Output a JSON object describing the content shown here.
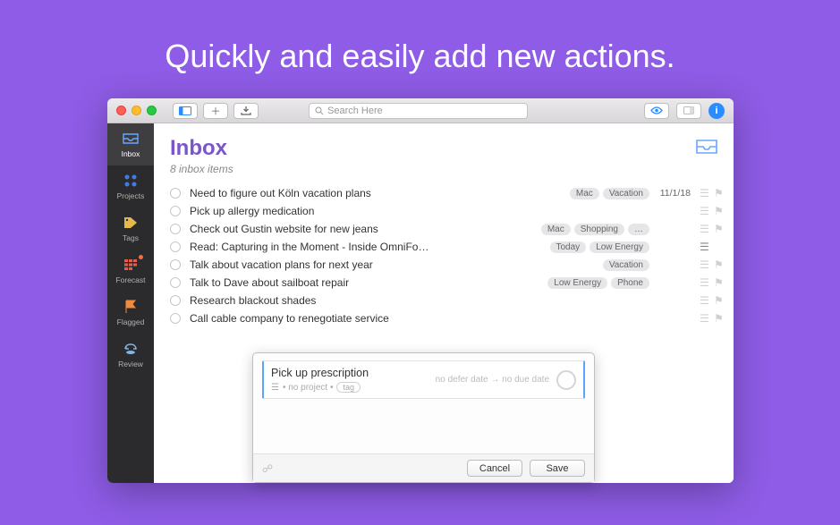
{
  "promo": {
    "title": "Quickly and easily add new actions."
  },
  "toolbar": {
    "search_placeholder": "Search Here"
  },
  "sidebar": {
    "items": [
      {
        "label": "Inbox"
      },
      {
        "label": "Projects"
      },
      {
        "label": "Tags"
      },
      {
        "label": "Forecast"
      },
      {
        "label": "Flagged"
      },
      {
        "label": "Review"
      }
    ]
  },
  "header": {
    "title": "Inbox",
    "subtitle": "8 inbox items"
  },
  "inbox": [
    {
      "title": "Need to figure out Köln vacation plans",
      "tags": [
        "Mac",
        "Vacation"
      ],
      "date": "11/1/18",
      "note": true,
      "flag": true
    },
    {
      "title": "Pick up allergy medication",
      "tags": [],
      "date": "",
      "note": true,
      "flag": true
    },
    {
      "title": "Check out Gustin website for new jeans",
      "tags": [
        "Mac",
        "Shopping",
        "…"
      ],
      "date": "",
      "note": true,
      "flag": true
    },
    {
      "title": "Read: Capturing in the Moment - Inside OmniFo…",
      "tags": [
        "Today",
        "Low Energy"
      ],
      "date": "",
      "note": true,
      "noteOn": true,
      "flag": false
    },
    {
      "title": "Talk about vacation plans for next year",
      "tags": [
        "Vacation"
      ],
      "date": "",
      "note": true,
      "flag": true
    },
    {
      "title": "Talk to Dave about sailboat repair",
      "tags": [
        "Low Energy",
        "Phone"
      ],
      "date": "",
      "note": true,
      "flag": true
    },
    {
      "title": "Research blackout shades",
      "tags": [],
      "date": "",
      "note": true,
      "flag": true
    },
    {
      "title": "Call cable company to renegotiate service",
      "tags": [],
      "date": "",
      "note": true,
      "flag": true
    }
  ],
  "quick_entry": {
    "title": "Pick up prescription",
    "no_project": "• no project •",
    "tag_placeholder": "tag",
    "defer": "no defer date",
    "arrow": "→",
    "due": "no due date",
    "cancel": "Cancel",
    "save": "Save"
  }
}
